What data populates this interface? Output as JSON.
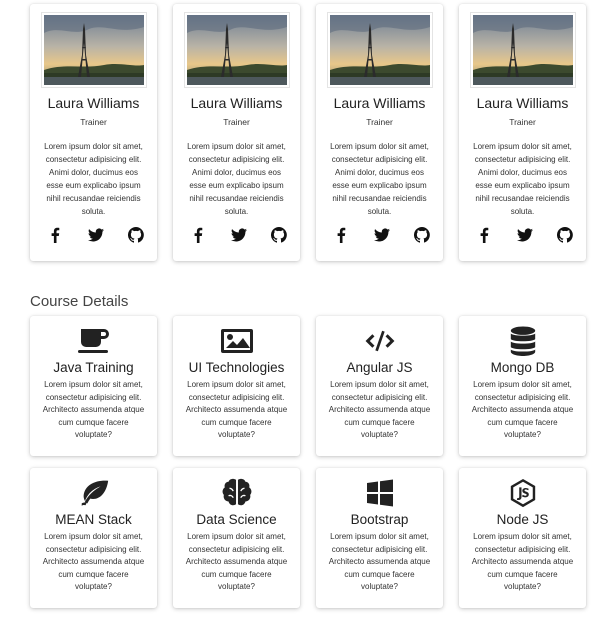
{
  "trainers": [
    {
      "name": "Laura Williams",
      "role": "Trainer",
      "description": "Lorem ipsum dolor sit amet, consectetur adipisicing elit. Animi dolor, ducimus eos esse eum explicabo ipsum nihil recusandae reiciendis soluta."
    },
    {
      "name": "Laura Williams",
      "role": "Trainer",
      "description": "Lorem ipsum dolor sit amet, consectetur adipisicing elit. Animi dolor, ducimus eos esse eum explicabo ipsum nihil recusandae reiciendis soluta."
    },
    {
      "name": "Laura Williams",
      "role": "Trainer",
      "description": "Lorem ipsum dolor sit amet, consectetur adipisicing elit. Animi dolor, ducimus eos esse eum explicabo ipsum nihil recusandae reiciendis soluta."
    },
    {
      "name": "Laura Williams",
      "role": "Trainer",
      "description": "Lorem ipsum dolor sit amet, consectetur adipisicing elit. Animi dolor, ducimus eos esse eum explicabo ipsum nihil recusandae reiciendis soluta."
    }
  ],
  "social_icons": [
    "facebook-icon",
    "twitter-icon",
    "github-icon"
  ],
  "course_section": {
    "title": "Course Details"
  },
  "courses": [
    {
      "title": "Java Training",
      "icon": "coffee-cup-icon",
      "description": "Lorem ipsum dolor sit amet, consectetur adipisicing elit. Architecto assumenda atque cum cumque facere voluptate?"
    },
    {
      "title": "UI Technologies",
      "icon": "image-icon",
      "description": "Lorem ipsum dolor sit amet, consectetur adipisicing elit. Architecto assumenda atque cum cumque facere voluptate?"
    },
    {
      "title": "Angular JS",
      "icon": "code-icon",
      "description": "Lorem ipsum dolor sit amet, consectetur adipisicing elit. Architecto assumenda atque cum cumque facere voluptate?"
    },
    {
      "title": "Mongo DB",
      "icon": "database-icon",
      "description": "Lorem ipsum dolor sit amet, consectetur adipisicing elit. Architecto assumenda atque cum cumque facere voluptate?"
    },
    {
      "title": "MEAN Stack",
      "icon": "leaf-icon",
      "description": "Lorem ipsum dolor sit amet, consectetur adipisicing elit. Architecto assumenda atque cum cumque facere voluptate?"
    },
    {
      "title": "Data Science",
      "icon": "brain-icon",
      "description": "Lorem ipsum dolor sit amet, consectetur adipisicing elit. Architecto assumenda atque cum cumque facere voluptate?"
    },
    {
      "title": "Bootstrap",
      "icon": "windows-icon",
      "description": "Lorem ipsum dolor sit amet, consectetur adipisicing elit. Architecto assumenda atque cum cumque facere voluptate?"
    },
    {
      "title": "Node JS",
      "icon": "nodejs-icon",
      "description": "Lorem ipsum dolor sit amet, consectetur adipisicing elit. Architecto assumenda atque cum cumque facere voluptate?"
    }
  ]
}
